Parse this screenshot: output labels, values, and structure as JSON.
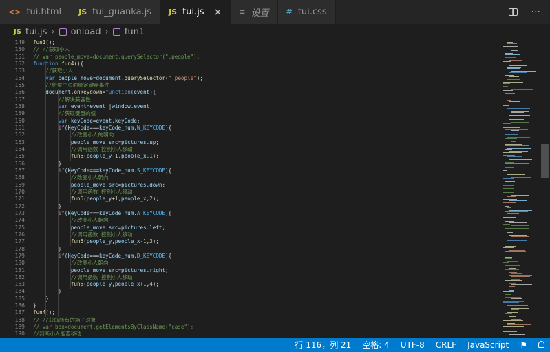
{
  "tabs": [
    {
      "icon": "<>",
      "label": "tui.html",
      "active": false
    },
    {
      "icon": "JS",
      "label": "tui_guanka.js",
      "active": false
    },
    {
      "icon": "JS",
      "label": "tui.js",
      "active": true,
      "close": "×"
    },
    {
      "icon": "≡",
      "label": "设置",
      "active": false
    },
    {
      "icon": "#",
      "label": "tui.css",
      "active": false
    }
  ],
  "tab_actions": {
    "more": "···"
  },
  "breadcrumb": [
    "tui.js",
    "onload",
    "fun1"
  ],
  "breadcrumb_js_icon": "JS",
  "lines": [
    {
      "n": "149",
      "t": [
        [
          "fun1",
          "#dcdcaa"
        ],
        [
          "();",
          "#d4d4d4"
        ]
      ]
    },
    {
      "n": "150",
      "t": [
        [
          "// //获取小人",
          "#6a9955"
        ]
      ]
    },
    {
      "n": "151",
      "t": [
        [
          "// var people_move=document.querySelector(\".people\");",
          "#6a9955"
        ]
      ]
    },
    {
      "n": "152",
      "t": [
        [
          "function ",
          "#569cd6"
        ],
        [
          "fun4",
          "#dcdcaa"
        ],
        [
          "(){",
          "#d4d4d4"
        ]
      ]
    },
    {
      "n": "153",
      "t": [
        [
          "    //获取小人",
          "#6a9955"
        ]
      ]
    },
    {
      "n": "154",
      "t": [
        [
          "    var ",
          "#569cd6"
        ],
        [
          "people_move",
          "#9cdcfe"
        ],
        [
          "=",
          "#d4d4d4"
        ],
        [
          "document",
          "#9cdcfe"
        ],
        [
          ".",
          "#d4d4d4"
        ],
        [
          "querySelector",
          "#dcdcaa"
        ],
        [
          "(",
          "#d4d4d4"
        ],
        [
          "\".people\"",
          "#ce9178"
        ],
        [
          ");",
          "#d4d4d4"
        ]
      ]
    },
    {
      "n": "155",
      "t": [
        [
          "    //给整个页面绑定键盘事件",
          "#6a9955"
        ]
      ]
    },
    {
      "n": "156",
      "t": [
        [
          "    document",
          "#9cdcfe"
        ],
        [
          ".",
          "#d4d4d4"
        ],
        [
          "onkeydown",
          "#dcdcaa"
        ],
        [
          "=",
          "#d4d4d4"
        ],
        [
          "function",
          "#569cd6"
        ],
        [
          "(",
          "#d4d4d4"
        ],
        [
          "event",
          "#9cdcfe"
        ],
        [
          "){",
          "#d4d4d4"
        ]
      ]
    },
    {
      "n": "157",
      "t": [
        [
          "        //解决兼容性",
          "#6a9955"
        ]
      ]
    },
    {
      "n": "158",
      "t": [
        [
          "        var ",
          "#569cd6"
        ],
        [
          "event",
          "#9cdcfe"
        ],
        [
          "=",
          "#d4d4d4"
        ],
        [
          "event",
          "#9cdcfe"
        ],
        [
          "||",
          "#d4d4d4"
        ],
        [
          "window",
          "#9cdcfe"
        ],
        [
          ".",
          "#d4d4d4"
        ],
        [
          "event",
          "#9cdcfe"
        ],
        [
          ";",
          "#d4d4d4"
        ]
      ]
    },
    {
      "n": "159",
      "t": [
        [
          "        //获取键盘的值",
          "#6a9955"
        ]
      ]
    },
    {
      "n": "160",
      "t": [
        [
          "        var ",
          "#569cd6"
        ],
        [
          "keyCode",
          "#9cdcfe"
        ],
        [
          "=",
          "#d4d4d4"
        ],
        [
          "event",
          "#9cdcfe"
        ],
        [
          ".",
          "#d4d4d4"
        ],
        [
          "keyCode",
          "#9cdcfe"
        ],
        [
          ";",
          "#d4d4d4"
        ]
      ]
    },
    {
      "n": "161",
      "t": [
        [
          "        if",
          "#c586c0"
        ],
        [
          "(",
          "#d4d4d4"
        ],
        [
          "keyCode",
          "#9cdcfe"
        ],
        [
          "===",
          "#d4d4d4"
        ],
        [
          "keyCode_num",
          "#9cdcfe"
        ],
        [
          ".",
          "#d4d4d4"
        ],
        [
          "W_KEYCODE",
          "#4fc1ff"
        ],
        [
          "){",
          "#d4d4d4"
        ]
      ]
    },
    {
      "n": "162",
      "t": [
        [
          "            //改变小人的朝向",
          "#6a9955"
        ]
      ]
    },
    {
      "n": "163",
      "t": [
        [
          "            people_move",
          "#9cdcfe"
        ],
        [
          ".",
          "#d4d4d4"
        ],
        [
          "src",
          "#9cdcfe"
        ],
        [
          "=",
          "#d4d4d4"
        ],
        [
          "pictures",
          "#9cdcfe"
        ],
        [
          ".",
          "#d4d4d4"
        ],
        [
          "up",
          "#9cdcfe"
        ],
        [
          ";",
          "#d4d4d4"
        ]
      ]
    },
    {
      "n": "164",
      "t": [
        [
          "            //调用函数 控制小人移动",
          "#6a9955"
        ]
      ]
    },
    {
      "n": "165",
      "t": [
        [
          "            fun5",
          "#dcdcaa"
        ],
        [
          "(",
          "#d4d4d4"
        ],
        [
          "people_y",
          "#9cdcfe"
        ],
        [
          "-",
          "#d4d4d4"
        ],
        [
          "1",
          "#b5cea8"
        ],
        [
          ",",
          "#d4d4d4"
        ],
        [
          "people_x",
          "#9cdcfe"
        ],
        [
          ",",
          "#d4d4d4"
        ],
        [
          "1",
          "#b5cea8"
        ],
        [
          ");",
          "#d4d4d4"
        ]
      ]
    },
    {
      "n": "166",
      "t": [
        [
          "        }",
          "#d4d4d4"
        ]
      ]
    },
    {
      "n": "167",
      "t": [
        [
          "        if",
          "#c586c0"
        ],
        [
          "(",
          "#d4d4d4"
        ],
        [
          "keyCode",
          "#9cdcfe"
        ],
        [
          "===",
          "#d4d4d4"
        ],
        [
          "keyCode_num",
          "#9cdcfe"
        ],
        [
          ".",
          "#d4d4d4"
        ],
        [
          "S_KEYCODE",
          "#4fc1ff"
        ],
        [
          "){",
          "#d4d4d4"
        ]
      ]
    },
    {
      "n": "168",
      "t": [
        [
          "            //改变小人朝向",
          "#6a9955"
        ]
      ]
    },
    {
      "n": "169",
      "t": [
        [
          "            people_move",
          "#9cdcfe"
        ],
        [
          ".",
          "#d4d4d4"
        ],
        [
          "src",
          "#9cdcfe"
        ],
        [
          "=",
          "#d4d4d4"
        ],
        [
          "pictures",
          "#9cdcfe"
        ],
        [
          ".",
          "#d4d4d4"
        ],
        [
          "down",
          "#9cdcfe"
        ],
        [
          ";",
          "#d4d4d4"
        ]
      ]
    },
    {
      "n": "170",
      "t": [
        [
          "            //调用函数 控制小人移动",
          "#6a9955"
        ]
      ]
    },
    {
      "n": "171",
      "t": [
        [
          "            fun5",
          "#dcdcaa"
        ],
        [
          "(",
          "#d4d4d4"
        ],
        [
          "people_y",
          "#9cdcfe"
        ],
        [
          "+",
          "#d4d4d4"
        ],
        [
          "1",
          "#b5cea8"
        ],
        [
          ",",
          "#d4d4d4"
        ],
        [
          "people_x",
          "#9cdcfe"
        ],
        [
          ",",
          "#d4d4d4"
        ],
        [
          "2",
          "#b5cea8"
        ],
        [
          ");",
          "#d4d4d4"
        ]
      ]
    },
    {
      "n": "172",
      "t": [
        [
          "        }",
          "#d4d4d4"
        ]
      ]
    },
    {
      "n": "173",
      "t": [
        [
          "        if",
          "#c586c0"
        ],
        [
          "(",
          "#d4d4d4"
        ],
        [
          "keyCode",
          "#9cdcfe"
        ],
        [
          "===",
          "#d4d4d4"
        ],
        [
          "keyCode_num",
          "#9cdcfe"
        ],
        [
          ".",
          "#d4d4d4"
        ],
        [
          "A_KEYCODE",
          "#4fc1ff"
        ],
        [
          "){",
          "#d4d4d4"
        ]
      ]
    },
    {
      "n": "174",
      "t": [
        [
          "            //改变小人朝向",
          "#6a9955"
        ]
      ]
    },
    {
      "n": "175",
      "t": [
        [
          "            people_move",
          "#9cdcfe"
        ],
        [
          ".",
          "#d4d4d4"
        ],
        [
          "src",
          "#9cdcfe"
        ],
        [
          "=",
          "#d4d4d4"
        ],
        [
          "pictures",
          "#9cdcfe"
        ],
        [
          ".",
          "#d4d4d4"
        ],
        [
          "left",
          "#9cdcfe"
        ],
        [
          ";",
          "#d4d4d4"
        ]
      ]
    },
    {
      "n": "176",
      "t": [
        [
          "            //调用函数 控制小人移动",
          "#6a9955"
        ]
      ]
    },
    {
      "n": "177",
      "t": [
        [
          "            fun5",
          "#dcdcaa"
        ],
        [
          "(",
          "#d4d4d4"
        ],
        [
          "people_y",
          "#9cdcfe"
        ],
        [
          ",",
          "#d4d4d4"
        ],
        [
          "people_x",
          "#9cdcfe"
        ],
        [
          "-",
          "#d4d4d4"
        ],
        [
          "1",
          "#b5cea8"
        ],
        [
          ",",
          "#d4d4d4"
        ],
        [
          "3",
          "#b5cea8"
        ],
        [
          ");",
          "#d4d4d4"
        ]
      ]
    },
    {
      "n": "178",
      "t": [
        [
          "        }",
          "#d4d4d4"
        ]
      ]
    },
    {
      "n": "179",
      "t": [
        [
          "        if",
          "#c586c0"
        ],
        [
          "(",
          "#d4d4d4"
        ],
        [
          "keyCode",
          "#9cdcfe"
        ],
        [
          "===",
          "#d4d4d4"
        ],
        [
          "keyCode_num",
          "#9cdcfe"
        ],
        [
          ".",
          "#d4d4d4"
        ],
        [
          "D_KEYCODE",
          "#4fc1ff"
        ],
        [
          "){",
          "#d4d4d4"
        ]
      ]
    },
    {
      "n": "180",
      "t": [
        [
          "            //改变小人朝向",
          "#6a9955"
        ]
      ]
    },
    {
      "n": "181",
      "t": [
        [
          "            people_move",
          "#9cdcfe"
        ],
        [
          ".",
          "#d4d4d4"
        ],
        [
          "src",
          "#9cdcfe"
        ],
        [
          "=",
          "#d4d4d4"
        ],
        [
          "pictures",
          "#9cdcfe"
        ],
        [
          ".",
          "#d4d4d4"
        ],
        [
          "right",
          "#9cdcfe"
        ],
        [
          ";",
          "#d4d4d4"
        ]
      ]
    },
    {
      "n": "182",
      "t": [
        [
          "            //调用函数 控制小人移动",
          "#6a9955"
        ]
      ]
    },
    {
      "n": "183",
      "t": [
        [
          "            fun5",
          "#dcdcaa"
        ],
        [
          "(",
          "#d4d4d4"
        ],
        [
          "people_y",
          "#9cdcfe"
        ],
        [
          ",",
          "#d4d4d4"
        ],
        [
          "people_x",
          "#9cdcfe"
        ],
        [
          "+",
          "#d4d4d4"
        ],
        [
          "1",
          "#b5cea8"
        ],
        [
          ",",
          "#d4d4d4"
        ],
        [
          "4",
          "#b5cea8"
        ],
        [
          ");",
          "#d4d4d4"
        ]
      ]
    },
    {
      "n": "184",
      "t": [
        [
          "        }",
          "#d4d4d4"
        ]
      ]
    },
    {
      "n": "185",
      "t": [
        [
          "    }",
          "#d4d4d4"
        ]
      ]
    },
    {
      "n": "186",
      "t": [
        [
          "}",
          "#d4d4d4"
        ]
      ]
    },
    {
      "n": "187",
      "t": [
        [
          "fun4",
          "#dcdcaa"
        ],
        [
          "();",
          "#d4d4d4"
        ]
      ]
    },
    {
      "n": "188",
      "t": [
        [
          "// //获取所有的箱子对象",
          "#6a9955"
        ]
      ]
    },
    {
      "n": "189",
      "t": [
        [
          "// var box=document.getElementsByClassName(\"case\");",
          "#6a9955"
        ]
      ]
    },
    {
      "n": "190",
      "t": [
        [
          "//判断小人能否移动",
          "#6a9955"
        ]
      ]
    }
  ],
  "status": {
    "position": "行 116，列 21",
    "indent": "空格: 4",
    "encoding": "UTF-8",
    "eol": "CRLF",
    "language": "JavaScript"
  },
  "colors": {
    "accent": "#007acc",
    "editor_bg": "#1e1e1e",
    "tabbar_bg": "#252526"
  }
}
